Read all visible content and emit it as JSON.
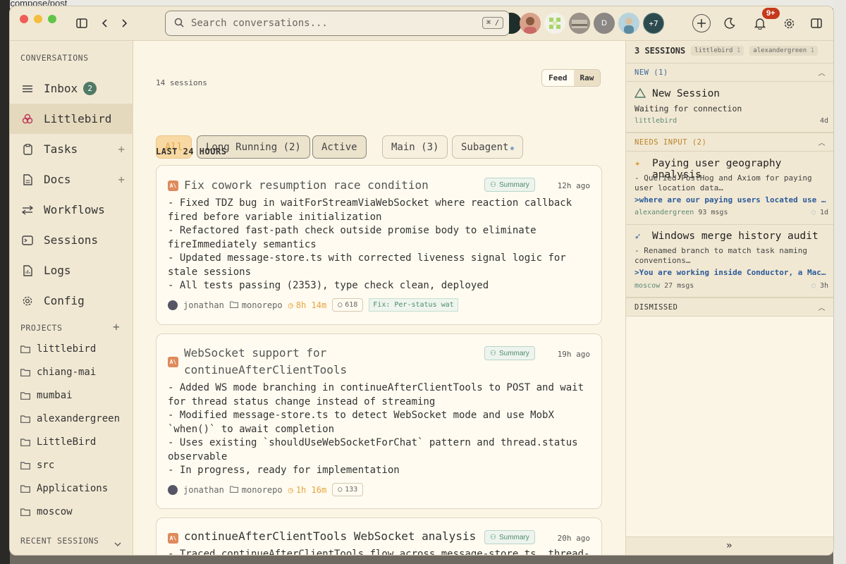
{
  "browser": {
    "url": "m/compose/post"
  },
  "topbar": {
    "search_placeholder": "Search conversations...",
    "search_shortcut": "⌘ /",
    "avatar_more": "+7",
    "notif_count": "9+"
  },
  "sidebar": {
    "conversations_header": "CONVERSATIONS",
    "nav": [
      {
        "label": "Inbox",
        "count": "2"
      },
      {
        "label": "Littlebird"
      },
      {
        "label": "Tasks"
      },
      {
        "label": "Docs"
      },
      {
        "label": "Workflows"
      },
      {
        "label": "Sessions"
      },
      {
        "label": "Logs"
      },
      {
        "label": "Config"
      }
    ],
    "projects_header": "PROJECTS",
    "projects": [
      "littlebird",
      "chiang-mai",
      "mumbai",
      "alexandergreen",
      "LittleBird",
      "src",
      "Applications",
      "moscow"
    ],
    "recent_header": "RECENT SESSIONS"
  },
  "main": {
    "session_count": "14 sessions",
    "view_toggle": [
      "Feed",
      "Raw"
    ],
    "filters": [
      "All",
      "Long Running (2)",
      "Active",
      "Main (3)",
      "Subagent"
    ],
    "section_title": "LAST 24 HOURS",
    "cards": [
      {
        "title": "Fix cowork resumption race condition",
        "summary": "Summary",
        "time": "12h ago",
        "body": "- Fixed TDZ bug in waitForStreamViaWebSocket where reaction callback fired before variable initialization\n- Refactored fast-path check outside promise body to eliminate fireImmediately semantics\n- Updated message-store.ts with corrected liveness signal logic for stale sessions\n- All tests passing (2353), type check clean, deployed",
        "user": "jonathan",
        "repo": "monorepo",
        "duration": "8h 14m",
        "msgs": "618",
        "tag": "Fix: Per-status wat"
      },
      {
        "title": "WebSocket support for continueAfterClientTools",
        "summary": "Summary",
        "time": "19h ago",
        "body": "- Added WS mode branching in continueAfterClientTools to POST and wait for thread status change instead of streaming\n- Modified message-store.ts to detect WebSocket mode and use MobX `when()` to await completion\n- Uses existing `shouldUseWebSocketForChat` pattern and thread.status observable\n- In progress, ready for implementation",
        "user": "jonathan",
        "repo": "monorepo",
        "duration": "1h 16m",
        "msgs": "133"
      },
      {
        "title": "continueAfterClientTools WebSocket analysis",
        "summary": "Summary",
        "time": "20h ago",
        "body": "- Traced continueAfterClientTools flow across message-store.ts, thread-"
      }
    ]
  },
  "right": {
    "header": "3 SESSIONS",
    "header_tags": [
      {
        "name": "littlebird",
        "n": "1"
      },
      {
        "name": "alexandergreen",
        "n": "1"
      }
    ],
    "groups": {
      "new": "NEW (1)",
      "needs_input": "NEEDS INPUT (2)",
      "dismissed": "DISMISSED"
    },
    "sessions": [
      {
        "title": "New Session",
        "desc": "Waiting for connection",
        "footer": "littlebird",
        "age": "4d"
      },
      {
        "title": "Paying user geography analysis",
        "desc": "- Queried PostHog and Axiom for paying user location data…",
        "question": ">where are our paying users located use p…",
        "footer_user": "alexandergreen",
        "footer_msgs": "93 msgs",
        "age": "1d"
      },
      {
        "title": "Windows merge history audit",
        "desc": "- Renamed branch to match task naming conventions…",
        "question": ">You are working inside Conductor, a Mac …",
        "footer_user": "moscow",
        "footer_msgs": "27 msgs",
        "age": "3h"
      }
    ],
    "collapse": "»"
  },
  "colors": {
    "accent_green": "#4f7a66",
    "notif_red": "#c6391c",
    "amber": "#e8a33c",
    "link_blue": "#2a5a9a"
  }
}
